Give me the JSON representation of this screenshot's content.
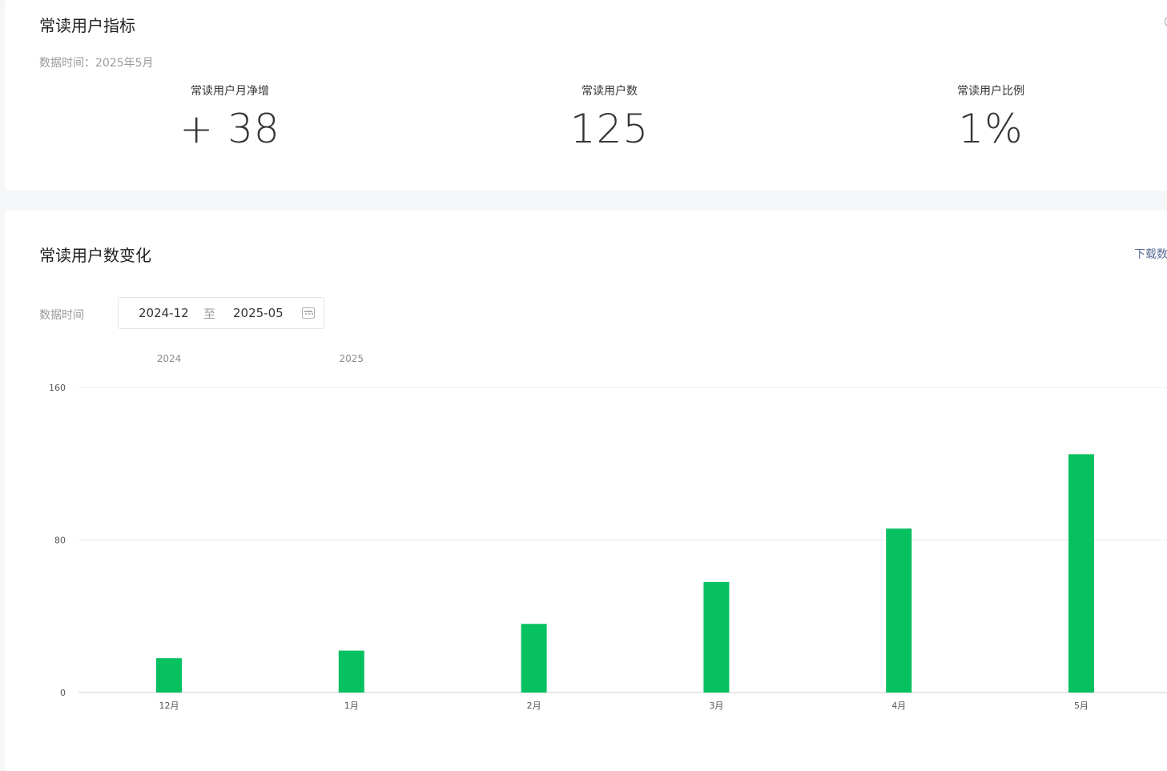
{
  "metrics_card": {
    "title": "常读用户指标",
    "data_time": "数据时间：2025年5月",
    "items": [
      {
        "label": "常读用户月净增",
        "value": "+ 38"
      },
      {
        "label": "常读用户数",
        "value": "125"
      },
      {
        "label": "常读用户比例",
        "value": "1%"
      }
    ]
  },
  "chart_card": {
    "title": "常读用户数变化",
    "download_label": "下载数",
    "range_label": "数据时间",
    "range_start": "2024-12",
    "range_separator": "至",
    "range_end": "2025-05"
  },
  "colors": {
    "bar": "#07c160",
    "grid": "#e9e9e9",
    "link": "#576b95"
  },
  "chart_data": {
    "type": "bar",
    "categories": [
      "12月",
      "1月",
      "2月",
      "3月",
      "4月",
      "5月"
    ],
    "year_labels": [
      {
        "text": "2024",
        "category_index": 0
      },
      {
        "text": "2025",
        "category_index": 1
      }
    ],
    "values": [
      18,
      22,
      36,
      58,
      86,
      125
    ],
    "yticks": [
      0,
      80,
      160
    ],
    "ylim": [
      0,
      160
    ],
    "title": "",
    "xlabel": "",
    "ylabel": "",
    "grid": true
  }
}
